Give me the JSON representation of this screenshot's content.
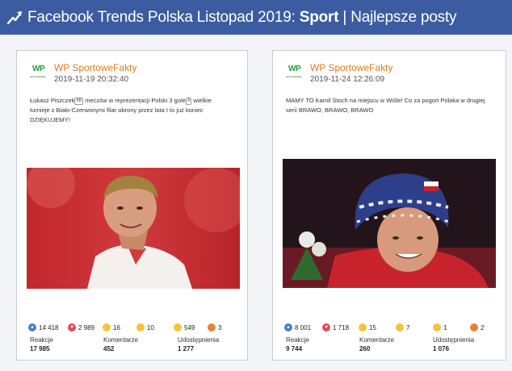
{
  "header": {
    "prefix": "Facebook Trends Polska Listopad 2019: ",
    "category": "Sport",
    "suffix": " | Najlepsze posty"
  },
  "posts": [
    {
      "page": "WP SportoweFakty",
      "logo_text": "WP",
      "logo_sub": "SportoweFakty",
      "date": "2019-11-19 20:32:40",
      "text_1": "Łukasz Piszczek",
      "badge_1": "66",
      "text_2": " meczów w reprezentacji Polski 3 gole",
      "badge_2": "4",
      "text_3": " wielkie turnieje z Biało-Czerwonymi filar obrony przez lata I to już koniec DZIĘKUJEMY!",
      "reactions": [
        "14 418",
        "2 989",
        "16",
        "10",
        "549",
        "3"
      ],
      "stats": [
        {
          "label": "Reakcje",
          "value": "17 985"
        },
        {
          "label": "Komentarze",
          "value": "452"
        },
        {
          "label": "Udostępnienia",
          "value": "1 277"
        }
      ]
    },
    {
      "page": "WP SportoweFakty",
      "logo_text": "WP",
      "logo_sub": "SportoweFakty",
      "date": "2019-11-24 12:26:09",
      "text": "MAMY TO Kamil Stoch na miejscu w Wiśle! Co za pogoń Polaka w drugiej serii BRAWO, BRAWO, BRAWO",
      "reactions": [
        "8 001",
        "1 718",
        "15",
        "7",
        "1",
        "2"
      ],
      "stats": [
        {
          "label": "Reakcje",
          "value": "9 744"
        },
        {
          "label": "Komentarze",
          "value": "260"
        },
        {
          "label": "Udostępnienia",
          "value": "1 076"
        }
      ]
    }
  ],
  "reaction_icons": [
    "like-icon",
    "love-icon",
    "haha-icon",
    "wow-icon",
    "sad-icon",
    "angry-icon"
  ],
  "colors": {
    "header_bg": "#3b5ca0",
    "page_name": "#e07b1e",
    "like": "#4a7bd0",
    "love": "#e8484f",
    "emoji": "#f5c33b",
    "angry": "#e8813a"
  }
}
